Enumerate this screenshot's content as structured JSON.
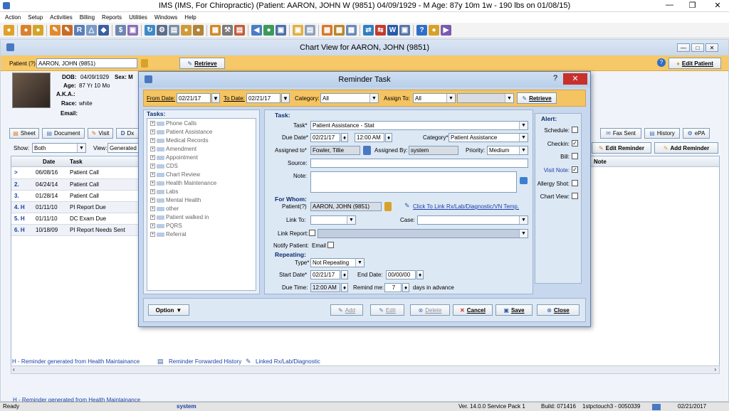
{
  "app": {
    "title": "IMS (IMS, For Chiropractic)    (Patient: AARON, JOHN W (9851) 04/09/1929 - M Age: 87y 10m 1w - 190 lbs on 01/08/15)"
  },
  "menu": [
    "Action",
    "Setup",
    "Activities",
    "Billing",
    "Reports",
    "Utilities",
    "Windows",
    "Help"
  ],
  "chart": {
    "caption": "Chart View for AARON, JOHN  (9851)",
    "patient_label": "Patient (?)",
    "patient_value": "AARON, JOHN  (9851)",
    "retrieve": "Retrieve",
    "edit_patient": "Edit Patient",
    "dob_label": "DOB:",
    "dob": "04/09/1929",
    "sex_label": "Sex: M",
    "age_label": "Age:",
    "age": "87 Yr 10 Mo",
    "aka_label": "A.K.A.:",
    "race_label": "Race:",
    "race": "white",
    "email_label": "Email:",
    "tabs": [
      "Sheet",
      "Document",
      "Visit",
      "Dx"
    ],
    "right_tabs": [
      "Fax Sent",
      "History",
      "ePA"
    ],
    "show_label": "Show:",
    "show_value": "Both",
    "view_label": "View:",
    "view_value": "Generated",
    "edit_reminder": "Edit Reminder",
    "add_reminder": "Add Reminder",
    "col_date": "Date",
    "col_task": "Task",
    "col_note": "Note",
    "rows": [
      {
        "mark": ">",
        "date": "06/08/16",
        "task": "Patient Call"
      },
      {
        "mark": "2.",
        "date": "04/24/14",
        "task": "Patient Call"
      },
      {
        "mark": "3.",
        "date": "01/28/14",
        "task": "Patient Call"
      },
      {
        "mark": "4.  H",
        "date": "01/11/10",
        "task": "PI Report Due"
      },
      {
        "mark": "5.  H",
        "date": "01/11/10",
        "task": "DC Exam Due"
      },
      {
        "mark": "6.  H",
        "date": "10/18/09",
        "task": "PI Report Needs Sent"
      }
    ],
    "legend_h": "H -  Reminder generated from Health Maintainance",
    "legend_fwd": "Reminder Forwarded History",
    "legend_link": "Linked Rx/Lab/Diagnostic"
  },
  "dialog": {
    "title": "Reminder Task",
    "help": "?",
    "from_date_label": "From Date:",
    "from_date": "02/21/17",
    "to_date_label": "To Date:",
    "to_date": "02/21/17",
    "category_label": "Category:",
    "category": "All",
    "assign_to_label": "Assign To:",
    "assign_to": "All",
    "retrieve": "Retrieve",
    "tasks_label": "Tasks:",
    "tasks": [
      "Phone Calls",
      "Patient Assistance",
      "Medical Records",
      "Amendment",
      "Appointment",
      "CDS",
      "Chart Review",
      "Health Maintenance",
      "Labs",
      "Mental Health",
      "other",
      "Patient walked in",
      "PQRS",
      "Referral"
    ],
    "task_section": "Task:",
    "task_label": "Task*",
    "task_value": "Patient Assistance - Stat",
    "due_date_label": "Due Date*",
    "due_date": "02/21/17",
    "due_time": "12:00 AM",
    "category_label2": "Category*",
    "category_value": "Patient Assistance",
    "assigned_to_label": "Assigned to*",
    "assigned_to": "Fowler, Tillie",
    "assigned_by_label": "Assigned By:",
    "assigned_by": "system",
    "priority_label": "Priority:",
    "priority": "Medium",
    "source_label": "Source:",
    "note_label": "Note:",
    "for_whom": "For Whom:",
    "patient_label": "Patient(?)",
    "patient_value": "AARON, JOHN  (9851)",
    "link_temp": "Click To Link Rx/Lab/Diagnostic/VN Temp.",
    "link_to_label": "Link To:",
    "case_label": "Case:",
    "link_report_label": "Link Report:",
    "notify_label": "Notify Patient:",
    "notify_email": "Email",
    "repeating": "Repeating:",
    "type_label": "Type*",
    "type_value": "Not Repeating",
    "start_date_label": "Start Date*",
    "start_date": "02/21/17",
    "end_date_label": "End Date:",
    "end_date": "00/00/00",
    "due_time_label": "Due Time:",
    "due_time2": "12:00 AM",
    "remind_label": "Remind me:",
    "remind_value": "7",
    "remind_suffix": "days in advance",
    "alert_title": "Alert:",
    "alerts": [
      {
        "label": "Schedule:",
        "checked": false
      },
      {
        "label": "Checkin:",
        "checked": true
      },
      {
        "label": "Bill:",
        "checked": false
      },
      {
        "label": "Visit Note:",
        "checked": true
      },
      {
        "label": "Allergy Shot:",
        "checked": false
      },
      {
        "label": "Chart View:",
        "checked": false
      }
    ],
    "option": "Option",
    "add": "Add",
    "edit": "Edit",
    "delete": "Delete",
    "cancel": "Cancel",
    "save": "Save",
    "close": "Close"
  },
  "status": {
    "ready": "Ready",
    "user": "system",
    "version": "Ver. 14.0.0 Service Pack 1",
    "build": "Build: 071416",
    "server": "1stpctouch3 - 0050339",
    "date": "02/21/2017"
  },
  "colors": {
    "accent_orange": "#f5c462",
    "caption_blue": "#c9d8ec",
    "link_blue": "#1a3fa6",
    "close_red": "#c8302b"
  }
}
